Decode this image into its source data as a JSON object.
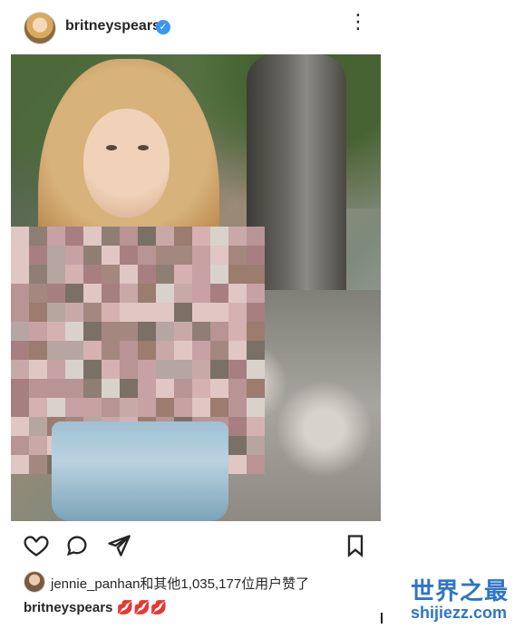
{
  "header": {
    "username": "britneyspears",
    "verified_mark": "✓",
    "more_glyph": "⋮"
  },
  "post": {
    "likes_text": "jennie_panhan和其他1,035,177位用户赞了",
    "caption_user": "britneyspears",
    "caption_text": "💋💋💋"
  },
  "icons": {
    "like": "heart-icon",
    "comment": "comment-icon",
    "share": "share-icon",
    "save": "bookmark-icon"
  },
  "watermark": {
    "title": "世界之最",
    "subtitle": "shijiezz.com"
  },
  "colors": {
    "verified_blue": "#3897f0",
    "text_primary": "#262626",
    "watermark_blue": "#2f74c7"
  }
}
